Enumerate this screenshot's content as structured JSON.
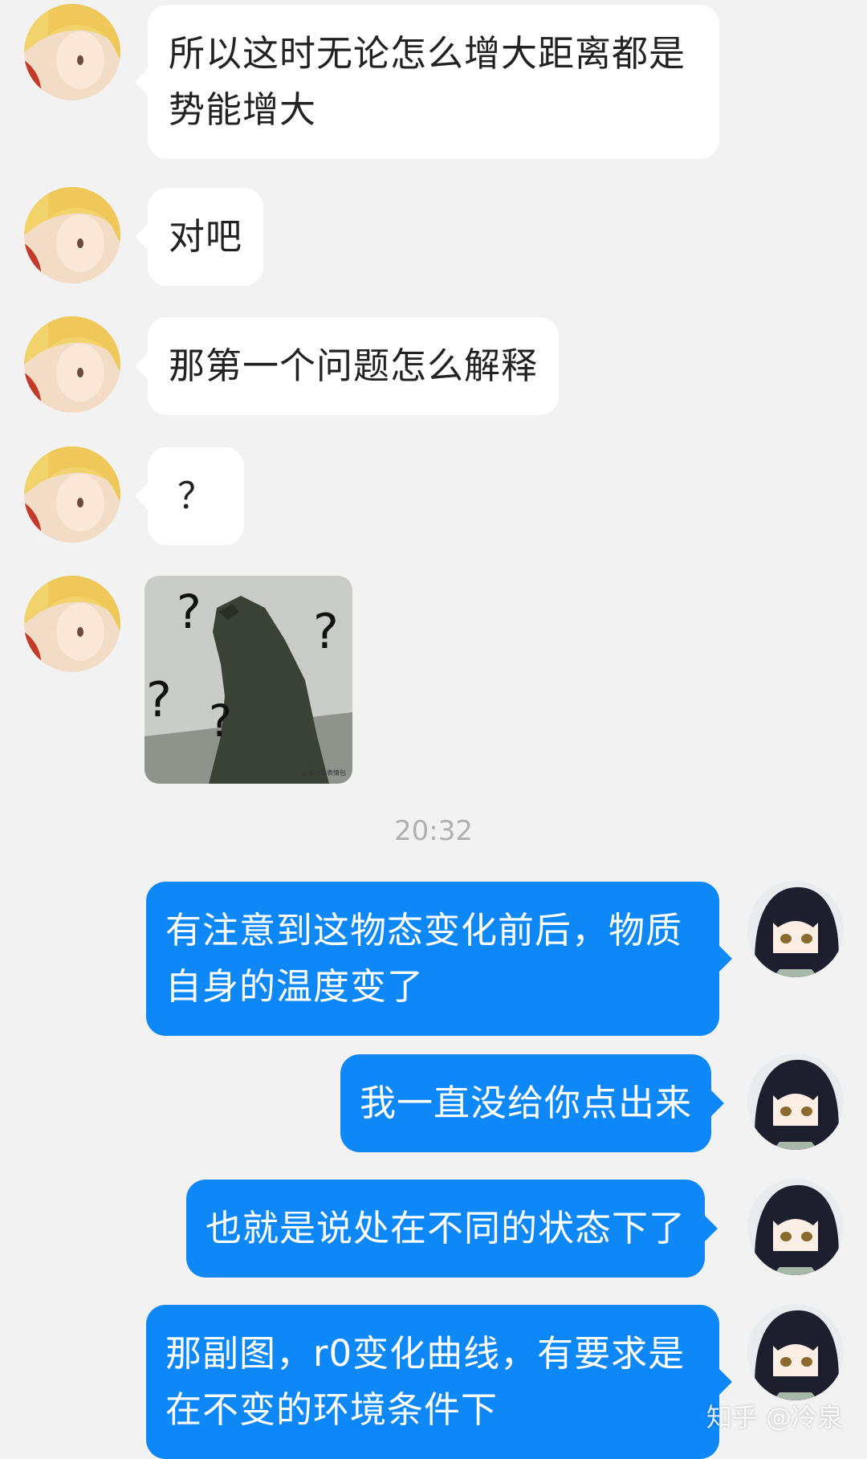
{
  "colors": {
    "background": "#f2f2f2",
    "incoming_bubble": "#ffffff",
    "outgoing_bubble": "#0e87f7",
    "timestamp_text": "#b0b0b0"
  },
  "incoming": [
    {
      "text": "所以这时无论怎么增大距离都是势能增大",
      "avatar": "blonde-anime-avatar"
    },
    {
      "text": "对吧",
      "avatar": "blonde-anime-avatar"
    },
    {
      "text": "那第一个问题怎么解释",
      "avatar": "blonde-anime-avatar"
    },
    {
      "text": "？",
      "avatar": "blonde-anime-avatar"
    }
  ],
  "sticker": {
    "marks": [
      "?",
      "?",
      "?",
      "?"
    ],
    "caption": "@高分数表情包"
  },
  "timestamp": "20:32",
  "outgoing": [
    {
      "text": "有注意到这物态变化前后，物质自身的温度变了",
      "avatar": "dark-haired-anime-avatar"
    },
    {
      "text": "我一直没给你点出来",
      "avatar": "dark-haired-anime-avatar"
    },
    {
      "text": "也就是说处在不同的状态下了",
      "avatar": "dark-haired-anime-avatar"
    },
    {
      "text": "那副图，r0变化曲线，有要求是在不变的环境条件下",
      "avatar": "dark-haired-anime-avatar"
    }
  ],
  "watermark": "知乎 @冷泉"
}
